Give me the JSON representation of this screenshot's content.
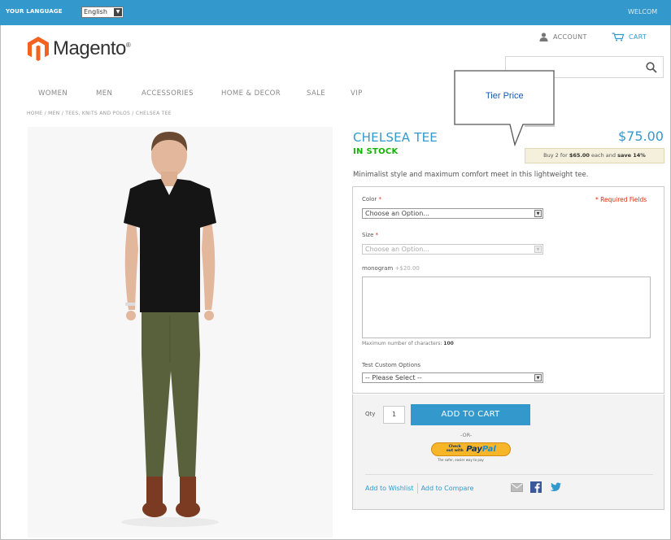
{
  "topbar": {
    "language_label": "YOUR LANGUAGE",
    "language_value": "English",
    "welcome": "WELCOM"
  },
  "header": {
    "logo_text": "Magento",
    "logo_reg": "®",
    "account_label": "ACCOUNT",
    "cart_label": "CART",
    "search_value": ""
  },
  "nav": {
    "items": [
      "WOMEN",
      "MEN",
      "ACCESSORIES",
      "HOME & DECOR",
      "SALE",
      "VIP"
    ]
  },
  "breadcrumb": "HOME / MEN / TEES, KNITS AND POLOS / CHELSEA TEE",
  "callout": {
    "text": "Tier Price"
  },
  "product": {
    "name": "CHELSEA TEE",
    "price": "$75.00",
    "stock": "IN STOCK",
    "tier_prefix": "Buy 2 for ",
    "tier_price": "$65.00",
    "tier_mid": " each and ",
    "tier_save": "save 14%",
    "description": "Minimalist style and maximum comfort meet in this lightweight tee."
  },
  "options": {
    "required_fields": "* Required Fields",
    "color_label": "Color",
    "color_value": "Choose an Option...",
    "size_label": "Size",
    "size_value": "Choose an Option...",
    "monogram_label": "monogram",
    "monogram_extra": "+$20.00",
    "max_chars_label": "Maximum number of characters:",
    "max_chars_value": "100",
    "custom_label": "Test Custom Options",
    "custom_value": "-- Please Select --",
    "required_star": "*"
  },
  "cart": {
    "qty_label": "Qty",
    "qty_value": "1",
    "add_to_cart": "ADD TO CART",
    "or": "-OR-",
    "paypal_checkout": "Check out with",
    "paypal_word_1": "Pay",
    "paypal_word_2": "Pal",
    "paypal_tagline": "The safer, easier way to pay",
    "wishlist": "Add to Wishlist",
    "compare": "Add to Compare"
  },
  "colors": {
    "accent": "#3399cc",
    "stock_green": "#11b400",
    "required_red": "#df280a",
    "logo_orange": "#f26322"
  }
}
